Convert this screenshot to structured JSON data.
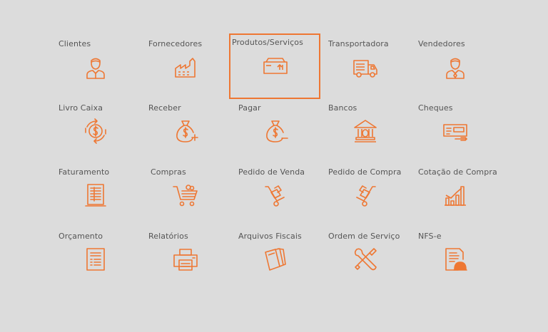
{
  "accent_color": "#ee7733",
  "tiles": [
    {
      "label": "Clientes",
      "icon": "person-icon"
    },
    {
      "label": "Fornecedores",
      "icon": "factory-icon"
    },
    {
      "label": "Produtos/Serviços",
      "icon": "box-icon",
      "selected": true
    },
    {
      "label": "Transportadora",
      "icon": "truck-icon"
    },
    {
      "label": "Vendedores",
      "icon": "salesperson-icon"
    },
    {
      "label": "Livro Caixa",
      "icon": "cash-cycle-icon"
    },
    {
      "label": "Receber",
      "icon": "money-bag-plus-icon"
    },
    {
      "label": "Pagar",
      "icon": "money-bag-minus-icon"
    },
    {
      "label": "Bancos",
      "icon": "bank-icon"
    },
    {
      "label": "Cheques",
      "icon": "check-icon"
    },
    {
      "label": "Faturamento",
      "icon": "invoice-icon"
    },
    {
      "label": "Compras",
      "icon": "shopping-cart-icon"
    },
    {
      "label": "Pedido de Venda",
      "icon": "hand-truck-icon"
    },
    {
      "label": "Pedido de Compra",
      "icon": "hand-truck-icon"
    },
    {
      "label": "Cotação de Compra",
      "icon": "bar-chart-icon"
    },
    {
      "label": "Orçamento",
      "icon": "document-icon"
    },
    {
      "label": "Relatórios",
      "icon": "printer-icon"
    },
    {
      "label": "Arquivos Fiscais",
      "icon": "files-icon"
    },
    {
      "label": "Ordem de Serviço",
      "icon": "tools-icon"
    },
    {
      "label": "NFS-e",
      "icon": "document-hardhat-icon"
    }
  ]
}
